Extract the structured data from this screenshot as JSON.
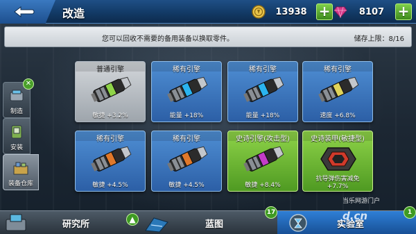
{
  "header": {
    "title": "改造",
    "gold": "13938",
    "gems": "8107"
  },
  "info": {
    "message": "您可以回收不需要的备用装备以换取零件。",
    "storage": "储存上限：8/16"
  },
  "sidebar": {
    "items": [
      {
        "label": "制造",
        "icon": "wrench-icon"
      },
      {
        "label": "安装",
        "icon": "install-icon"
      },
      {
        "label": "装备仓库",
        "icon": "warehouse-icon"
      }
    ]
  },
  "cards": [
    {
      "title": "普通引擎",
      "stat": "敏捷 +3.2%",
      "rarity": "common",
      "band": "#8fd449"
    },
    {
      "title": "稀有引擎",
      "stat": "能量 +18%",
      "rarity": "rare",
      "band": "#2ab3ef"
    },
    {
      "title": "稀有引擎",
      "stat": "能量 +18%",
      "rarity": "rare",
      "band": "#2ab3ef"
    },
    {
      "title": "稀有引擎",
      "stat": "速度 +6.8%",
      "rarity": "rare",
      "band": "#e0d35a"
    },
    {
      "title": "稀有引擎",
      "stat": "敏捷 +4.5%",
      "rarity": "rare",
      "band": "#e0782a"
    },
    {
      "title": "稀有引擎",
      "stat": "敏捷 +4.5%",
      "rarity": "rare",
      "band": "#e0782a"
    },
    {
      "title": "史诗引擎(攻击型)",
      "stat": "敏捷 +8.4%",
      "rarity": "epic",
      "band": "#c23cc7"
    },
    {
      "title": "史诗装甲(敏捷型)",
      "stat": "抗导弹伤害减免",
      "stat2": "+7.7%",
      "rarity": "epic",
      "band": "#d13a2a"
    }
  ],
  "bottomnav": {
    "items": [
      {
        "label": "研究所",
        "badge": "",
        "icon": "research-icon"
      },
      {
        "label": "蓝图",
        "badge": "17",
        "icon": "blueprint-icon"
      },
      {
        "label": "实验室",
        "badge": "1",
        "icon": "lab-icon"
      }
    ]
  },
  "watermark": {
    "text": "当乐网游门户",
    "logo": "d.cn"
  },
  "colors": {
    "accent": "#2f7fd6",
    "plus": "#4aa02a"
  }
}
